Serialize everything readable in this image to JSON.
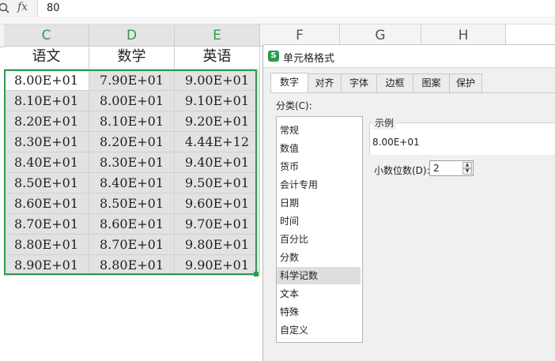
{
  "formula_bar": {
    "fx_symbol": "fx",
    "value": "80"
  },
  "columns": [
    {
      "letter": "C",
      "selected": true
    },
    {
      "letter": "D",
      "selected": true
    },
    {
      "letter": "E",
      "selected": true
    },
    {
      "letter": "F",
      "selected": false
    },
    {
      "letter": "G",
      "selected": false
    },
    {
      "letter": "H",
      "selected": false
    }
  ],
  "sheet": {
    "headers": [
      "语文",
      "数学",
      "英语"
    ],
    "rows": [
      [
        "8.00E+01",
        "7.90E+01",
        "9.00E+01"
      ],
      [
        "8.10E+01",
        "8.00E+01",
        "9.10E+01"
      ],
      [
        "8.20E+01",
        "8.10E+01",
        "9.20E+01"
      ],
      [
        "8.30E+01",
        "8.20E+01",
        "4.44E+12"
      ],
      [
        "8.40E+01",
        "8.30E+01",
        "9.40E+01"
      ],
      [
        "8.50E+01",
        "8.40E+01",
        "9.50E+01"
      ],
      [
        "8.60E+01",
        "8.50E+01",
        "9.60E+01"
      ],
      [
        "8.70E+01",
        "8.60E+01",
        "9.70E+01"
      ],
      [
        "8.80E+01",
        "8.70E+01",
        "9.80E+01"
      ],
      [
        "8.90E+01",
        "8.80E+01",
        "9.90E+01"
      ]
    ]
  },
  "dialog": {
    "title": "单元格格式",
    "logo": "S",
    "tabs": [
      "数字",
      "对齐",
      "字体",
      "边框",
      "图案",
      "保护"
    ],
    "active_tab": 0,
    "category_label": "分类(C):",
    "categories": [
      "常规",
      "数值",
      "货币",
      "会计专用",
      "日期",
      "时间",
      "百分比",
      "分数",
      "科学记数",
      "文本",
      "特殊",
      "自定义"
    ],
    "selected_category": 8,
    "sample_label": "示例",
    "sample_value": "8.00E+01",
    "decimal_label": "小数位数(D):",
    "decimal_value": "2"
  },
  "colors": {
    "accent": "#2f9a4d",
    "selection_fill": "#e2e2e2"
  }
}
